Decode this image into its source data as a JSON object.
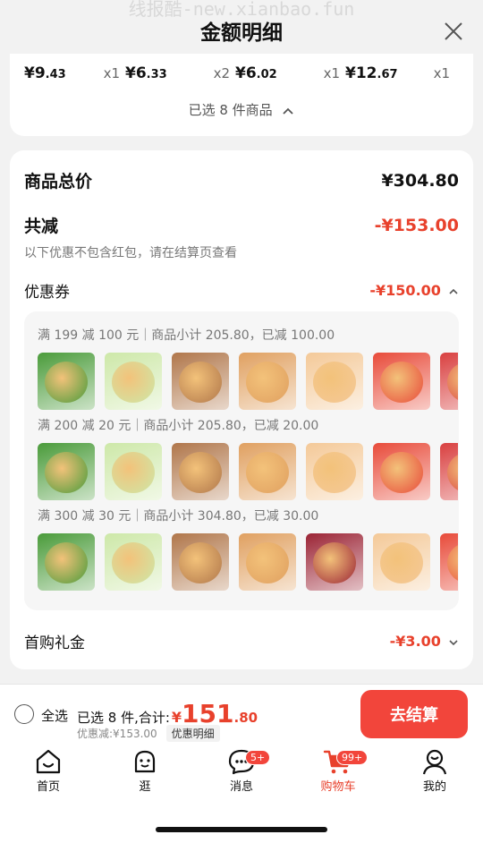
{
  "watermark": "线报酷-new.xianbao.fun",
  "header": {
    "title": "金额明细"
  },
  "items": [
    {
      "int": "¥9",
      "dec": ".43",
      "qty": "x1"
    },
    {
      "int": "¥6",
      "dec": ".33",
      "qty": "x2"
    },
    {
      "int": "¥6",
      "dec": ".02",
      "qty": "x1"
    },
    {
      "int": "¥12",
      "dec": ".67",
      "qty": "x1"
    }
  ],
  "selected_line": "已选 8 件商品",
  "summary": {
    "total_label": "商品总价",
    "total_value": "¥304.80",
    "reduce_label": "共减",
    "reduce_value": "-¥153.00",
    "note": "以下优惠不包含红包，请在结算页查看",
    "coupon_label": "优惠券",
    "coupon_value": "-¥150.00",
    "first_label": "首购礼金",
    "first_value": "-¥3.00"
  },
  "coupon_groups": [
    {
      "title": "满 199 减 100 元｜商品小计 205.80，已减 100.00",
      "thumbs": [
        "#4a9b3a",
        "#cde8a8",
        "#b0764a",
        "#e0a060",
        "#f4c998",
        "#e84b3a",
        "#d94040",
        "#e84b3a"
      ]
    },
    {
      "title": "满 200 减 20 元｜商品小计 205.80，已减 20.00",
      "thumbs": [
        "#4a9b3a",
        "#cde8a8",
        "#b0764a",
        "#e0a060",
        "#f4c998",
        "#e84b3a",
        "#d94040",
        "#e84b3a"
      ]
    },
    {
      "title": "满 300 减 30 元｜商品小计 304.80，已减 30.00",
      "thumbs": [
        "#4a9b3a",
        "#cde8a8",
        "#b0764a",
        "#e0a060",
        "#9b2435",
        "#f4c998",
        "#e84b3a",
        "#e84b3a"
      ]
    }
  ],
  "bottom": {
    "select_all": "全选",
    "sum_prefix": "已选 8 件,合计:",
    "yen": "¥",
    "sum_int": "151",
    "sum_dec": ".80",
    "discount": "优惠减:¥153.00",
    "detail_tag": "优惠明细",
    "checkout": "去结算"
  },
  "tabs": [
    {
      "label": "首页",
      "icon": "home-icon"
    },
    {
      "label": "逛",
      "icon": "face-icon"
    },
    {
      "label": "消息",
      "icon": "message-icon",
      "badge": "5+"
    },
    {
      "label": "购物车",
      "icon": "cart-icon",
      "badge": "99+"
    },
    {
      "label": "我的",
      "icon": "profile-icon"
    }
  ]
}
